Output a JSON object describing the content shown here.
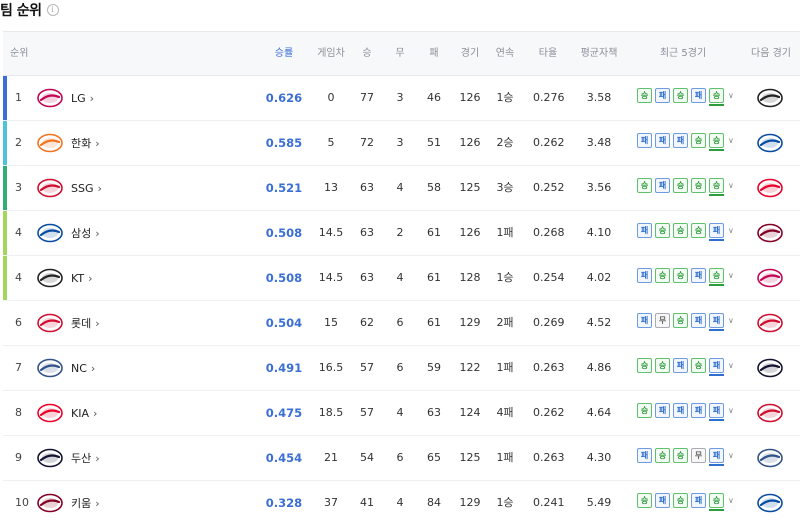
{
  "page": {
    "title": "팀 순위",
    "info_icon": "info-icon"
  },
  "table": {
    "headers": {
      "rank": "순위",
      "winrate": "승률",
      "gamesback": "게임차",
      "win": "승",
      "draw": "무",
      "loss": "패",
      "games": "경기",
      "streak": "연속",
      "avg": "타율",
      "era": "평균자책",
      "recent": "최근 5경기",
      "next": "다음 경기"
    },
    "rows": [
      {
        "rank": "1",
        "team": "LG",
        "winrate": "0.626",
        "gamesback": "0",
        "win": "77",
        "draw": "3",
        "loss": "46",
        "games": "126",
        "streak": "1승",
        "avg": "0.276",
        "era": "3.58",
        "recent": [
          "승",
          "패",
          "승",
          "패",
          "승"
        ],
        "rank_color": "#3b6fd6",
        "logo": "twins",
        "next": "kt"
      },
      {
        "rank": "2",
        "team": "한화",
        "winrate": "0.585",
        "gamesback": "5",
        "win": "72",
        "draw": "3",
        "loss": "51",
        "games": "126",
        "streak": "2승",
        "avg": "0.262",
        "era": "3.48",
        "recent": [
          "패",
          "패",
          "패",
          "승",
          "승"
        ],
        "rank_color": "#4fc3d9",
        "logo": "eagles",
        "next": "lions"
      },
      {
        "rank": "3",
        "team": "SSG",
        "winrate": "0.521",
        "gamesback": "13",
        "win": "63",
        "draw": "4",
        "loss": "58",
        "games": "125",
        "streak": "3승",
        "avg": "0.252",
        "era": "3.56",
        "recent": [
          "승",
          "패",
          "승",
          "승",
          "승"
        ],
        "rank_color": "#2fae77",
        "logo": "landers",
        "next": "tigers"
      },
      {
        "rank": "4",
        "team": "삼성",
        "winrate": "0.508",
        "gamesback": "14.5",
        "win": "63",
        "draw": "2",
        "loss": "61",
        "games": "126",
        "streak": "1패",
        "avg": "0.268",
        "era": "4.10",
        "recent": [
          "패",
          "승",
          "승",
          "승",
          "패"
        ],
        "rank_color": "#a3d65a",
        "logo": "lions",
        "next": "heroes"
      },
      {
        "rank": "4",
        "team": "KT",
        "winrate": "0.508",
        "gamesback": "14.5",
        "win": "63",
        "draw": "4",
        "loss": "61",
        "games": "128",
        "streak": "1승",
        "avg": "0.254",
        "era": "4.02",
        "recent": [
          "패",
          "승",
          "승",
          "패",
          "승"
        ],
        "rank_color": "#a3d65a",
        "logo": "kt",
        "next": "twins"
      },
      {
        "rank": "6",
        "team": "롯데",
        "winrate": "0.504",
        "gamesback": "15",
        "win": "62",
        "draw": "6",
        "loss": "61",
        "games": "129",
        "streak": "2패",
        "avg": "0.269",
        "era": "4.52",
        "recent": [
          "패",
          "무",
          "승",
          "패",
          "패"
        ],
        "rank_color": "",
        "logo": "giants",
        "next": "landers"
      },
      {
        "rank": "7",
        "team": "NC",
        "winrate": "0.491",
        "gamesback": "16.5",
        "win": "57",
        "draw": "6",
        "loss": "59",
        "games": "122",
        "streak": "1패",
        "avg": "0.263",
        "era": "4.86",
        "recent": [
          "승",
          "승",
          "패",
          "승",
          "패"
        ],
        "rank_color": "",
        "logo": "dinos",
        "next": "bears"
      },
      {
        "rank": "8",
        "team": "KIA",
        "winrate": "0.475",
        "gamesback": "18.5",
        "win": "57",
        "draw": "4",
        "loss": "63",
        "games": "124",
        "streak": "4패",
        "avg": "0.262",
        "era": "4.64",
        "recent": [
          "승",
          "패",
          "패",
          "패",
          "패"
        ],
        "rank_color": "",
        "logo": "tigers",
        "next": "landers"
      },
      {
        "rank": "9",
        "team": "두산",
        "winrate": "0.454",
        "gamesback": "21",
        "win": "54",
        "draw": "6",
        "loss": "65",
        "games": "125",
        "streak": "1패",
        "avg": "0.263",
        "era": "4.30",
        "recent": [
          "패",
          "승",
          "승",
          "무",
          "패"
        ],
        "rank_color": "",
        "logo": "bears",
        "next": "dinos"
      },
      {
        "rank": "10",
        "team": "키움",
        "winrate": "0.328",
        "gamesback": "37",
        "win": "41",
        "draw": "4",
        "loss": "84",
        "games": "129",
        "streak": "1승",
        "avg": "0.241",
        "era": "5.49",
        "recent": [
          "승",
          "패",
          "승",
          "패",
          "승"
        ],
        "rank_color": "",
        "logo": "heroes",
        "next": "lions"
      }
    ]
  },
  "logo_text": {
    "twins": "TWINS",
    "eagles": "Eagles",
    "landers": "Landers",
    "lions": "Lions",
    "kt": "kt wiz",
    "giants": "Giants",
    "dinos": "Dinos",
    "tigers": "TIGERS",
    "bears": "Bears",
    "heroes": "Heroes"
  },
  "logo_colors": {
    "twins": "#c30452",
    "eagles": "#f37321",
    "landers": "#ce0e2d",
    "lions": "#074ca1",
    "kt": "#222222",
    "giants": "#d00f31",
    "dinos": "#315288",
    "tigers": "#ea0029",
    "bears": "#131230",
    "heroes": "#820024"
  }
}
